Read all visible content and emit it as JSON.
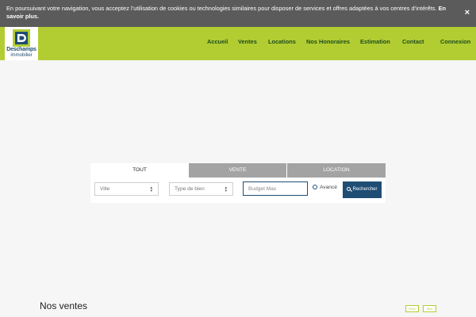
{
  "cookie_banner": {
    "text": "En poursuivant votre navigation, vous acceptez l’utilisation de cookies ou technologies similaires pour disposer de services et offres adaptées à vos centres d’intérêts.",
    "link_text": "En savoir plus.",
    "close_label": "×"
  },
  "logo": {
    "line1": "Deschamps",
    "line2": "immobilier"
  },
  "nav": {
    "items": [
      "Accueil",
      "Ventes",
      "Locations",
      "Nos Honoraires",
      "Estimation",
      "Contact"
    ],
    "login": "Connexion"
  },
  "search": {
    "tabs": [
      {
        "label": "TOUT",
        "active": true
      },
      {
        "label": "VENTE",
        "active": false
      },
      {
        "label": "LOCATION",
        "active": false
      }
    ],
    "city_placeholder": "Ville",
    "type_placeholder": "Type de bien",
    "budget_placeholder": "Budget Max",
    "advanced_label": "Avancé",
    "submit_label": "Rechercher"
  },
  "listings": {
    "title": "Nos ventes",
    "prev_label": "Prec",
    "next_label": "Suiv"
  },
  "colors": {
    "accent_green": "#b2cd32",
    "brand_blue": "#1f4d73",
    "banner_gray": "#5b5b5b"
  }
}
